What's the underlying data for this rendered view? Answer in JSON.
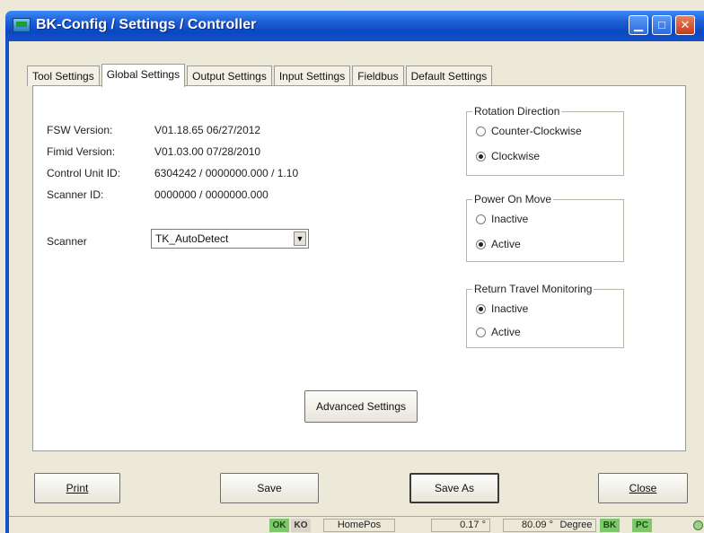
{
  "window": {
    "title": "BK-Config / Settings / Controller",
    "controls": {
      "minimize": "▁",
      "maximize": "□",
      "close": "✕"
    }
  },
  "tabs": [
    {
      "label": "Tool Settings"
    },
    {
      "label": "Global Settings"
    },
    {
      "label": "Output Settings"
    },
    {
      "label": "Input Settings"
    },
    {
      "label": "Fieldbus"
    },
    {
      "label": "Default Settings"
    }
  ],
  "info": {
    "fsw_label": "FSW Version:",
    "fsw_value": "V01.18.65 06/27/2012",
    "firmid_label": "Fimid Version:",
    "firmid_value": "V01.03.00 07/28/2010",
    "cu_label": "Control Unit ID:",
    "cu_value": "6304242 / 0000000.000 / 1.10",
    "scanner_id_label": "Scanner ID:",
    "scanner_id_value": "0000000 / 0000000.000",
    "scanner_label": "Scanner",
    "scanner_value": "TK_AutoDetect"
  },
  "rotation": {
    "title": "Rotation Direction",
    "options": [
      "Counter-Clockwise",
      "Clockwise"
    ],
    "selected": "Clockwise"
  },
  "power_on_move": {
    "title": "Power On Move",
    "options": [
      "Inactive",
      "Active"
    ],
    "selected": "Active"
  },
  "return_travel": {
    "title": "Return Travel Monitoring",
    "options": [
      "Inactive",
      "Active"
    ],
    "selected": "Inactive"
  },
  "buttons": {
    "advanced": "Advanced Settings",
    "print": "Print",
    "save": "Save",
    "save_as": "Save As",
    "close": "Close"
  },
  "status": {
    "ok": "OK",
    "ko": "KO",
    "position": "HomePos",
    "value1": "0.17 °",
    "value2": "80.09 °",
    "unit": "Degree",
    "bk": "BK",
    "pc": "PC"
  },
  "colors": {
    "titlebar": "#1552c9",
    "status_green": "#7dc86a"
  }
}
